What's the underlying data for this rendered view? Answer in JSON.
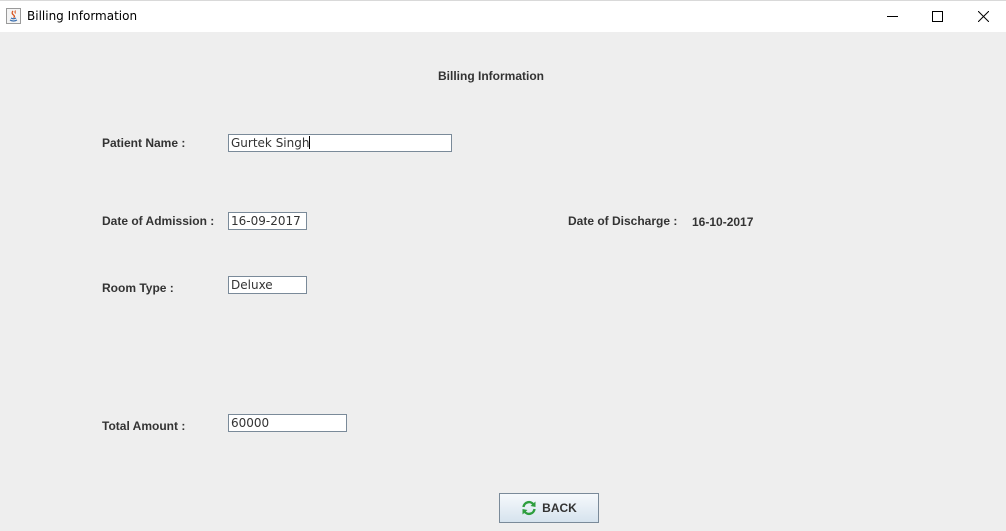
{
  "window": {
    "title": "Billing Information",
    "controls": {
      "minimize": "minimize-icon",
      "maximize": "maximize-icon",
      "close": "close-icon"
    }
  },
  "form": {
    "heading": "Billing Information",
    "patient_name": {
      "label": "Patient Name :",
      "value": "Gurtek Singh"
    },
    "date_of_admission": {
      "label": "Date of Admission :",
      "value": "16-09-2017"
    },
    "date_of_discharge": {
      "label": "Date of Discharge :",
      "value": "16-10-2017"
    },
    "room_type": {
      "label": "Room Type :",
      "value": "Deluxe"
    },
    "total_amount": {
      "label": "Total Amount :",
      "value": "60000"
    }
  },
  "actions": {
    "back_label": "BACK",
    "back_icon": "refresh-icon",
    "icon_color": "#2e9e3e"
  }
}
